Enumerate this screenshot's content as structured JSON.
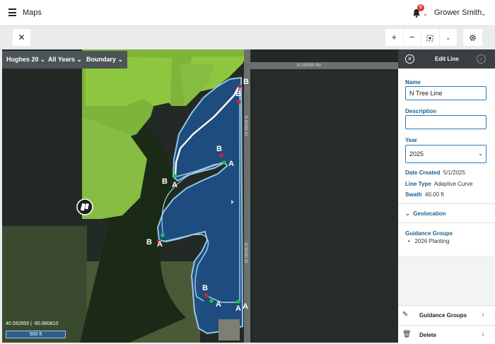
{
  "header": {
    "app_title": "Maps",
    "notification_count": "8",
    "user_name": "Grower Smith"
  },
  "toolbar": {
    "close_label": "✕",
    "zoom_in": "+",
    "zoom_out": "−",
    "chevron": "⌄"
  },
  "map": {
    "filters": [
      {
        "label": "Hughes 20"
      },
      {
        "label": "All Years"
      },
      {
        "label": "Boundary"
      }
    ],
    "road_labels": [
      "N 2500th Rd",
      "N 500th St",
      "N 500th St"
    ],
    "coordinates": "40.592855 | -90.880810",
    "scale_label": "500 ft",
    "point_labels": [
      "B",
      "B",
      "B",
      "A",
      "B",
      "A",
      "B",
      "A",
      "B",
      "A",
      "A",
      "A"
    ],
    "colors": {
      "boundary_fill": "#1e4f86",
      "boundary_stroke": "#9fd3f0",
      "field_green": "#8ec63f",
      "selected_line": "#ffffff",
      "point_a": "#19c14a",
      "point_b": "#d0242f"
    }
  },
  "panel": {
    "title": "Edit Line",
    "name_label": "Name",
    "name_value": "N Tree Line",
    "description_label": "Description",
    "description_value": "",
    "year_label": "Year",
    "year_value": "2025",
    "date_created_label": "Date Created",
    "date_created_value": "5/1/2025",
    "line_type_label": "Line Type",
    "line_type_value": "Adaptive Curve",
    "swath_label": "Swath",
    "swath_value": "40.00 ft",
    "geolocation_label": "Geolocation",
    "guidance_groups_label": "Guidance Groups",
    "guidance_groups": [
      "2026 Planting"
    ],
    "actions": [
      {
        "label": "Guidance Groups",
        "icon": "pencil-icon"
      },
      {
        "label": "Delete",
        "icon": "trash-icon"
      }
    ]
  }
}
